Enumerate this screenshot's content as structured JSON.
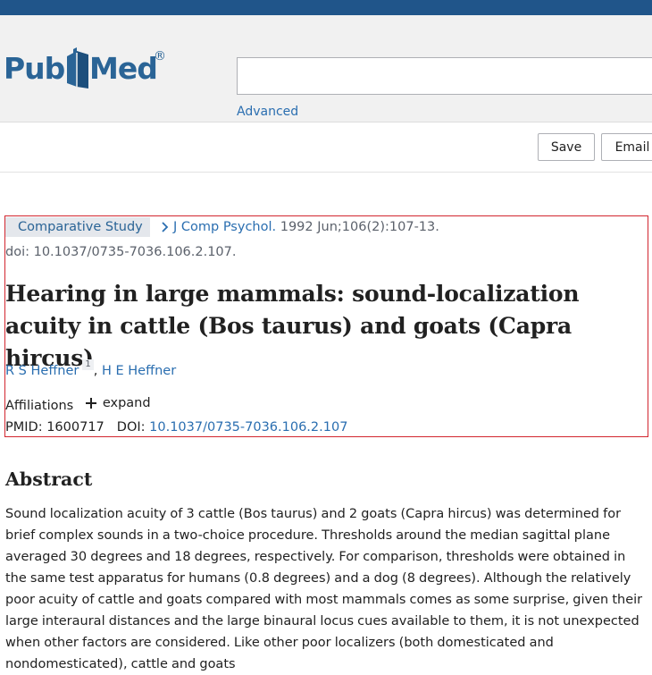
{
  "header": {
    "logo": {
      "part1": "Pub",
      "part2": "Med",
      "registered": "®"
    },
    "search": {
      "value": "",
      "placeholder": ""
    },
    "advanced_label": "Advanced"
  },
  "toolbar": {
    "save_label": "Save",
    "email_label": "Email"
  },
  "article": {
    "publication_type": "Comparative Study",
    "journal": "J Comp Psychol.",
    "citation": " 1992 Jun;106(2):107-13.",
    "doi_line": "doi: 10.1037/0735-7036.106.2.107.",
    "title": "Hearing in large mammals: sound-localization acuity in cattle (Bos taurus) and goats (Capra hircus)",
    "authors": [
      {
        "name": "R S Heffner",
        "affiliation_number": "1"
      },
      {
        "name": "H E Heffner"
      }
    ],
    "author_separator": ", ",
    "affiliations_label": "Affiliations",
    "expand_label": "expand",
    "pmid_label": "PMID: ",
    "pmid": "1600717",
    "doi_label": "DOI: ",
    "doi": "10.1037/0735-7036.106.2.107"
  },
  "abstract": {
    "heading": "Abstract",
    "text": "Sound localization acuity of 3 cattle (Bos taurus) and 2 goats (Capra hircus) was determined for brief complex sounds in a two-choice procedure. Thresholds around the median sagittal plane averaged 30 degrees and 18 degrees, respectively. For comparison, thresholds were obtained in the same test apparatus for humans (0.8 degrees) and a dog (8 degrees). Although the relatively poor acuity of cattle and goats compared with most mammals comes as some surprise, given their large interaural distances and the large binaural locus cues available to them, it is not unexpected when other factors are considered. Like other poor localizers (both domesticated and nondomesticated), cattle and goats"
  },
  "colors": {
    "topbar": "#20558a",
    "link": "#2a6eb0",
    "logo": "#2a6496",
    "highlight_border": "#d2262f"
  }
}
